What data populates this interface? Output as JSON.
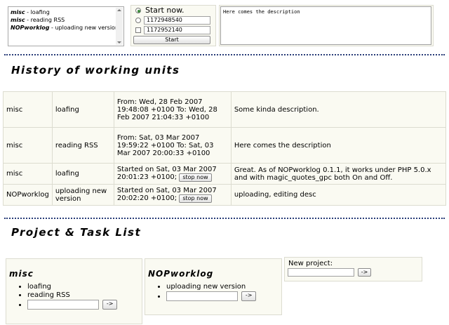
{
  "top_panel": {
    "recent_list": [
      {
        "project": "misc",
        "task": "loafing"
      },
      {
        "project": "misc",
        "task": "reading RSS"
      },
      {
        "project": "NOPworklog",
        "task": "uploading new version"
      }
    ],
    "start_now_label": "Start now.",
    "time_field_1": "1172948540",
    "time_field_2": "1172952140",
    "start_button": "Start",
    "description_value": "Here comes the description"
  },
  "history": {
    "title": "History of working units",
    "rows": [
      {
        "project": "misc",
        "task": "loafing",
        "time": "From: Wed, 28 Feb 2007 19:48:08 +0100 To: Wed, 28 Feb 2007 21:04:33 +0100",
        "stop_label": "",
        "description": "Some kinda description."
      },
      {
        "project": "misc",
        "task": "reading RSS",
        "time": "From: Sat, 03 Mar 2007 19:59:22 +0100 To: Sat, 03 Mar 2007 20:00:33 +0100",
        "stop_label": "",
        "description": "Here comes the description"
      },
      {
        "project": "misc",
        "task": "loafing",
        "time": "Started on Sat, 03 Mar 2007 20:01:23 +0100;",
        "stop_label": "stop now",
        "description": "Great. As of NOPworklog 0.1.1, it works under PHP 5.0.x and with magic_quotes_gpc both On and Off."
      },
      {
        "project": "NOPworklog",
        "task": "uploading new version",
        "time": "Started on Sat, 03 Mar 2007 20:02:20 +0100;",
        "stop_label": "stop now",
        "description": "uploading, editing desc"
      }
    ]
  },
  "projects": {
    "title": "Project & Task List",
    "list": [
      {
        "name": "misc",
        "tasks": [
          "loafing",
          "reading RSS"
        ],
        "add_button": "->"
      },
      {
        "name": "NOPworklog",
        "tasks": [
          "uploading new version"
        ],
        "add_button": "->"
      }
    ],
    "new_project_label": "New project:",
    "new_project_button": "->"
  }
}
